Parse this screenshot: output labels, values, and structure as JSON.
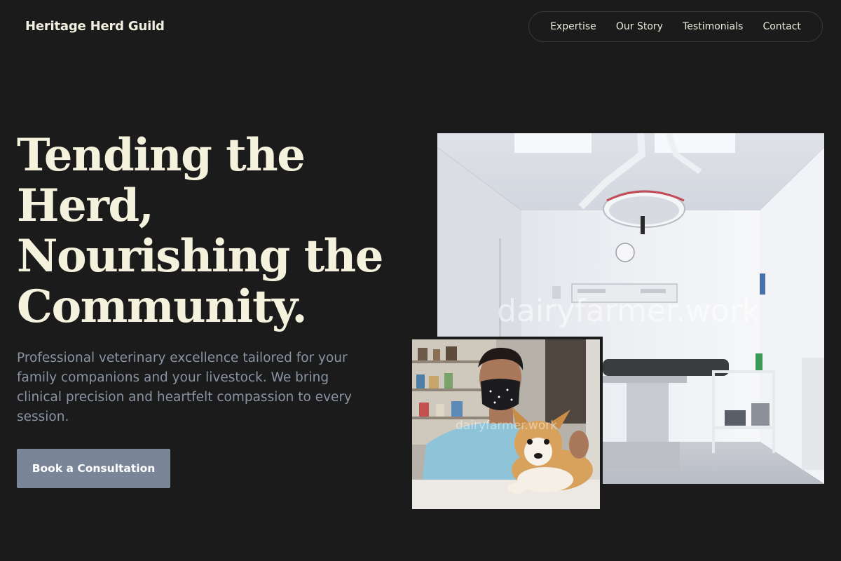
{
  "header": {
    "brand": "Heritage Herd Guild",
    "nav": [
      {
        "label": "Expertise"
      },
      {
        "label": "Our Story"
      },
      {
        "label": "Testimonials"
      },
      {
        "label": "Contact"
      }
    ]
  },
  "hero": {
    "title_lines": [
      "Tending the",
      "Herd,",
      "Nourishing the",
      "Community."
    ],
    "subtitle": "Professional veterinary excellence tailored for your family companions and your livestock. We bring clinical precision and heartfelt compassion to every session.",
    "cta_label": "Book a Consultation"
  },
  "images": {
    "main_watermark": "dairyfarmer.work",
    "inset_watermark": "dairyfarmer.work"
  },
  "colors": {
    "background": "#1b1b1b",
    "title": "#f4f1dc",
    "subtitle": "#8a93a2",
    "cta": "#7a8698"
  }
}
